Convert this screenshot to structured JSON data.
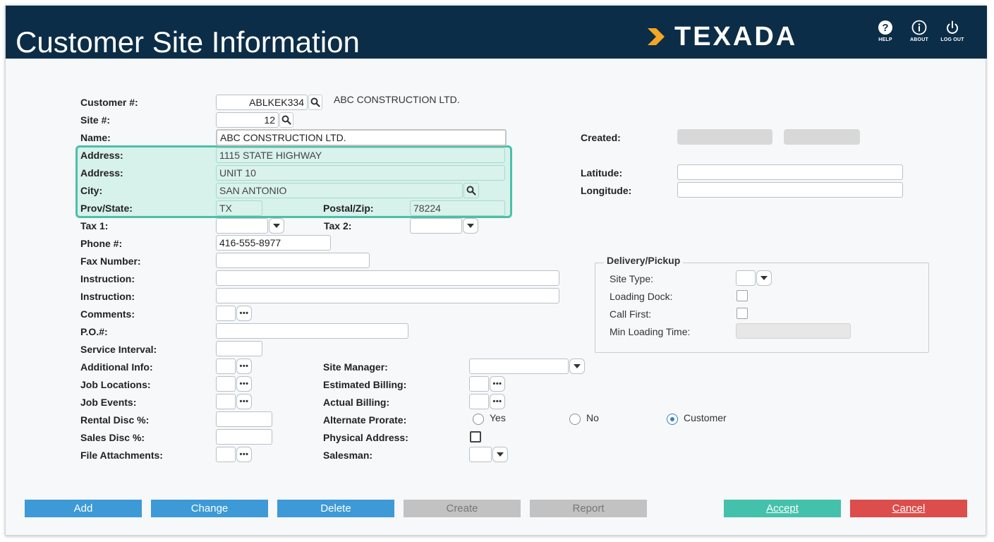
{
  "header": {
    "title": "Customer Site Information",
    "logo_text": "TEXADA",
    "help_label": "HELP",
    "about_label": "ABOUT",
    "logout_label": "LOG OUT",
    "bg_color": "#0b2d48"
  },
  "form": {
    "customer_label": "Customer #:",
    "customer_value": "ABLKEK334",
    "customer_name_display": "ABC CONSTRUCTION LTD.",
    "site_label": "Site #:",
    "site_value": "12",
    "name_label": "Name:",
    "name_value": "ABC CONSTRUCTION LTD.",
    "address1_label": "Address:",
    "address1_value": "1115 STATE HIGHWAY",
    "address2_label": "Address:",
    "address2_value": "UNIT 10",
    "city_label": "City:",
    "city_value": "SAN ANTONIO",
    "prov_label": "Prov/State:",
    "prov_value": "TX",
    "postal_label": "Postal/Zip:",
    "postal_value": "78224",
    "tax1_label": "Tax 1:",
    "tax2_label": "Tax 2:",
    "phone_label": "Phone #:",
    "phone_value": "416-555-8977",
    "fax_label": "Fax Number:",
    "instruction1_label": "Instruction:",
    "instruction2_label": "Instruction:",
    "comments_label": "Comments:",
    "po_label": "P.O.#:",
    "service_interval_label": "Service Interval:",
    "additional_info_label": "Additional Info:",
    "job_locations_label": "Job Locations:",
    "job_events_label": "Job Events:",
    "rental_disc_label": "Rental Disc %:",
    "sales_disc_label": "Sales Disc %:",
    "file_attachments_label": "File Attachments:",
    "site_manager_label": "Site Manager:",
    "estimated_billing_label": "Estimated Billing:",
    "actual_billing_label": "Actual Billing:",
    "alternate_prorate_label": "Alternate Prorate:",
    "prorate_options": [
      "Yes",
      "No",
      "Customer"
    ],
    "prorate_selected": "Customer",
    "physical_address_label": "Physical Address:",
    "salesman_label": "Salesman:",
    "created_label": "Created:",
    "latitude_label": "Latitude:",
    "longitude_label": "Longitude:",
    "more_glyph": "•••"
  },
  "delivery": {
    "legend": "Delivery/Pickup",
    "site_type_label": "Site Type:",
    "loading_dock_label": "Loading Dock:",
    "call_first_label": "Call First:",
    "min_loading_time_label": "Min Loading Time:"
  },
  "buttons": {
    "add": "Add",
    "change": "Change",
    "delete": "Delete",
    "create": "Create",
    "report": "Report",
    "accept": "Accept",
    "cancel": "Cancel"
  },
  "colors": {
    "highlight_border": "#4cbfaa",
    "highlight_fill": "#d7f1eb",
    "button_blue": "#3d9ad6",
    "button_gray": "#c2c2c2",
    "button_teal": "#44c1aa",
    "button_red": "#dc4d4b"
  }
}
